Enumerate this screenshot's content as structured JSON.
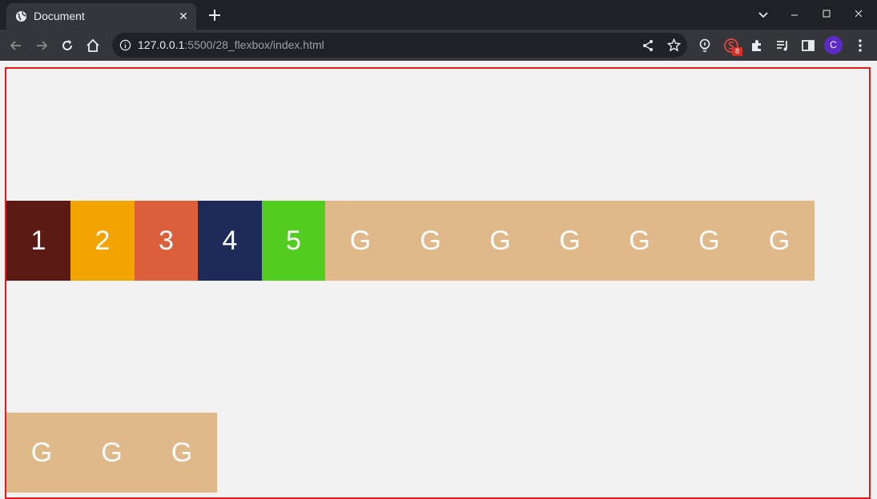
{
  "browser": {
    "tab_title": "Document",
    "tab_close": "✕",
    "new_tab": "+",
    "window_controls": {
      "chevron": "⌄",
      "minimize": "–",
      "maximize": "☐",
      "close": "✕"
    },
    "address": {
      "host": "127.0.0.1",
      "path": ":5500/28_flexbox/index.html"
    },
    "extension_badge": "8",
    "profile_initial": "C",
    "icons": [
      "globe-icon",
      "back-icon",
      "forward-icon",
      "reload-icon",
      "home-icon",
      "info-icon",
      "share-icon",
      "star-icon",
      "bulb-extension-icon",
      "s-extension-icon",
      "puzzle-icon",
      "media-queue-icon",
      "side-panel-icon",
      "kebab-menu-icon"
    ]
  },
  "page": {
    "row1": [
      {
        "label": "1",
        "color": "#5b1a14"
      },
      {
        "label": "2",
        "color": "#f2a500"
      },
      {
        "label": "3",
        "color": "#dc5f3b"
      },
      {
        "label": "4",
        "color": "#1e2a57"
      },
      {
        "label": "5",
        "color": "#52cc1f"
      },
      {
        "label": "G",
        "color": "#dfb98a"
      },
      {
        "label": "G",
        "color": "#dfb98a"
      },
      {
        "label": "G",
        "color": "#dfb98a"
      },
      {
        "label": "G",
        "color": "#dfb98a"
      },
      {
        "label": "G",
        "color": "#dfb98a"
      },
      {
        "label": "G",
        "color": "#dfb98a"
      },
      {
        "label": "G",
        "color": "#dfb98a"
      }
    ],
    "row2": [
      {
        "label": "G",
        "color": "#dfb98a"
      },
      {
        "label": "G",
        "color": "#dfb98a"
      },
      {
        "label": "G",
        "color": "#dfb98a"
      }
    ],
    "border_color": "#e01b1b",
    "background": "#f2f2f2"
  }
}
